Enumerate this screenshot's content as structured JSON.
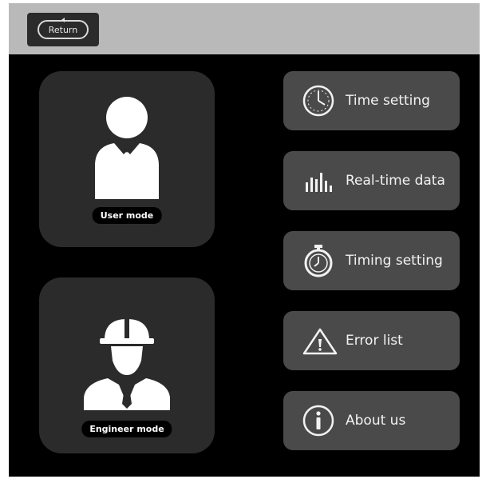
{
  "topbar": {
    "return_label": "Return"
  },
  "modes": [
    {
      "label": "User mode",
      "icon": "user-icon"
    },
    {
      "label": "Engineer mode",
      "icon": "engineer-icon"
    }
  ],
  "menu": [
    {
      "label": "Time setting",
      "icon": "clock-icon"
    },
    {
      "label": "Real-time data",
      "icon": "bar-chart-icon"
    },
    {
      "label": "Timing setting",
      "icon": "stopwatch-icon"
    },
    {
      "label": "Error list",
      "icon": "warning-icon"
    },
    {
      "label": "About us",
      "icon": "info-icon"
    }
  ],
  "colors": {
    "background": "#000000",
    "topbar": "#b9b9b9",
    "card": "#2b2b2b",
    "menu_button": "#4a4a4a",
    "text": "#f2f2f2"
  }
}
